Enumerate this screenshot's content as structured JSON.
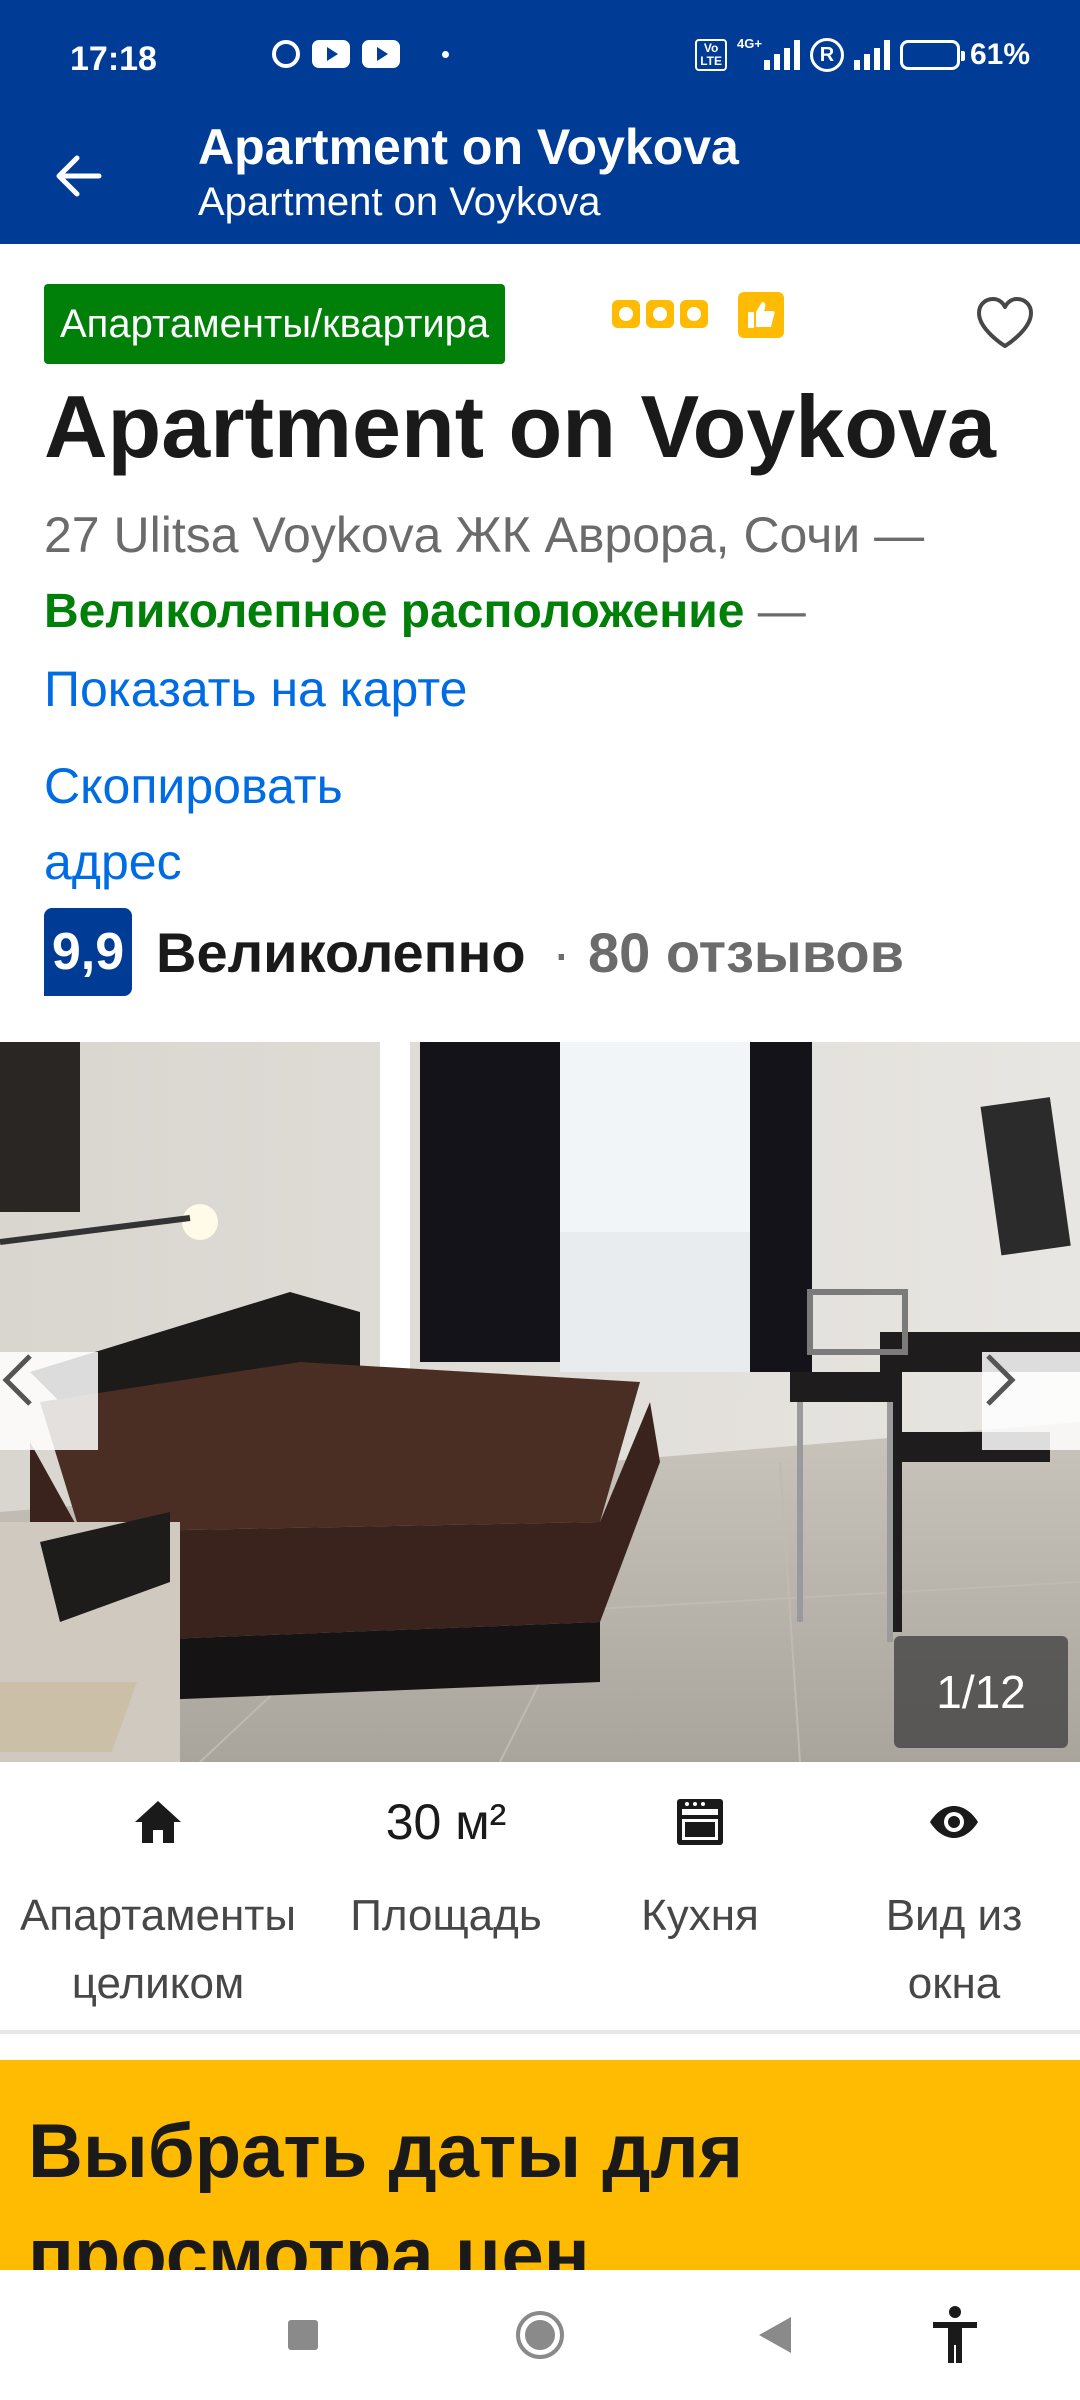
{
  "status_bar": {
    "time": "17:18",
    "network": "4G+",
    "battery_percent": 61,
    "battery_label": "61%"
  },
  "app_bar": {
    "title": "Apartment on Voykova",
    "subtitle": "Apartment on Voykova",
    "back_icon": "arrow-left-icon"
  },
  "property": {
    "type_badge": "Апартаменты/квартира",
    "quality_rating": 3,
    "name": "Apartment on Voykova",
    "address": "27 Ulitsa Voykova ЖК Аврора, Сочи —",
    "location_score": "Великолепное расположение",
    "separator": "—",
    "show_on_map": "Показать на карте",
    "copy_address": "Скопировать адрес",
    "review_score": "9,9",
    "review_word": "Великолепно",
    "review_separator": "·",
    "review_count": "80 отзывов"
  },
  "gallery": {
    "counter": "1/12",
    "current": 1,
    "total": 12
  },
  "facilities": [
    {
      "icon": "home-icon",
      "label": "Апартаменты целиком"
    },
    {
      "value": "30 м²",
      "label": "Площадь"
    },
    {
      "icon": "kitchen-icon",
      "label": "Кухня"
    },
    {
      "icon": "eye-icon",
      "label": "Вид из окна"
    }
  ],
  "date_banner": {
    "title": "Выбрать даты для просмотра цен"
  },
  "colors": {
    "brand_blue": "#003b95",
    "badge_green": "#008009",
    "link_blue": "#006ce4",
    "accent_yellow": "#febb02"
  }
}
